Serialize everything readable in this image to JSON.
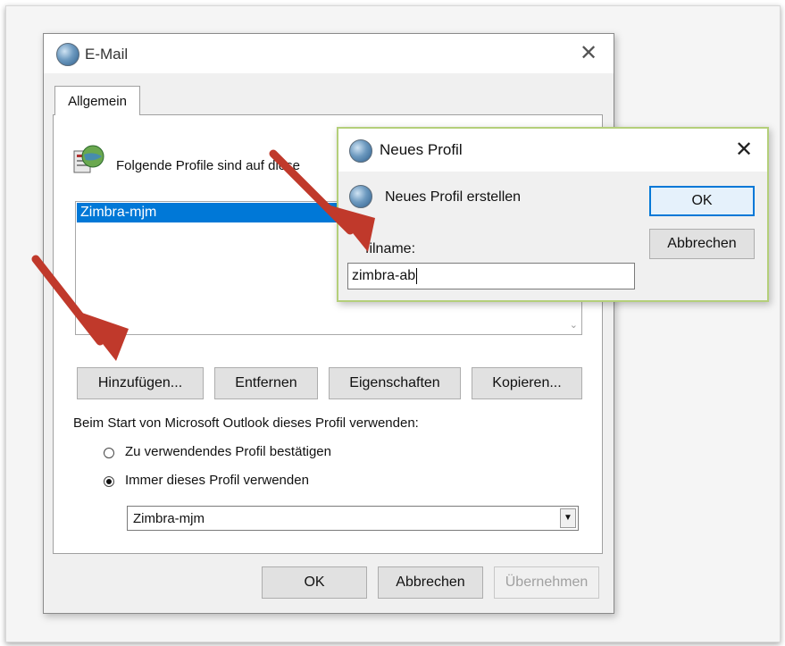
{
  "email_dialog": {
    "title": "E-Mail",
    "tab_label": "Allgemein",
    "profiles_caption": "Folgende Profile sind auf diese",
    "profiles": [
      "Zimbra-mjm"
    ],
    "buttons": {
      "add": "Hinzufügen...",
      "remove": "Entfernen",
      "properties": "Eigenschaften",
      "copy": "Kopieren..."
    },
    "startup_label": "Beim Start von Microsoft Outlook dieses Profil verwenden:",
    "radio_confirm": "Zu verwendendes Profil bestätigen",
    "radio_always": "Immer dieses Profil verwenden",
    "selected_profile": "Zimbra-mjm",
    "footer": {
      "ok": "OK",
      "cancel": "Abbrechen",
      "apply": "Übernehmen"
    }
  },
  "new_profile_dialog": {
    "title": "Neues Profil",
    "heading": "Neues Profil erstellen",
    "field_label": "filname:",
    "field_value": "zimbra-ab",
    "ok": "OK",
    "cancel": "Abbrechen"
  },
  "colors": {
    "annotation_arrow": "#c0392b",
    "selection": "#0078d7",
    "new_profile_border": "#b4cf7a"
  },
  "icons": {
    "email_title": "mail-globe-icon",
    "profiles": "profiles-server-icon",
    "new_profile_title": "mail-globe-icon",
    "new_profile_heading": "mail-globe-icon"
  }
}
